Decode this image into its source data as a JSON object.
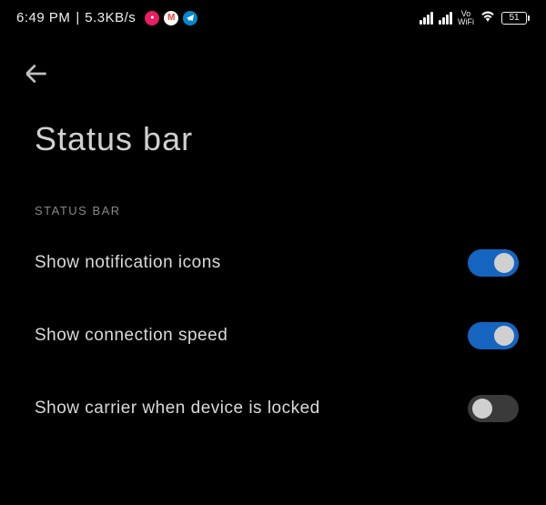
{
  "statusbar": {
    "time": "6:49 PM",
    "separator": "|",
    "speed": "5.3KB/s",
    "vowifi_top": "Vo",
    "vowifi_bottom": "WiFi",
    "battery": "51"
  },
  "page": {
    "title": "Status bar"
  },
  "section": {
    "header": "STATUS BAR"
  },
  "settings": [
    {
      "label": "Show notification icons",
      "enabled": true
    },
    {
      "label": "Show connection speed",
      "enabled": true
    },
    {
      "label": "Show carrier when device is locked",
      "enabled": false
    }
  ]
}
